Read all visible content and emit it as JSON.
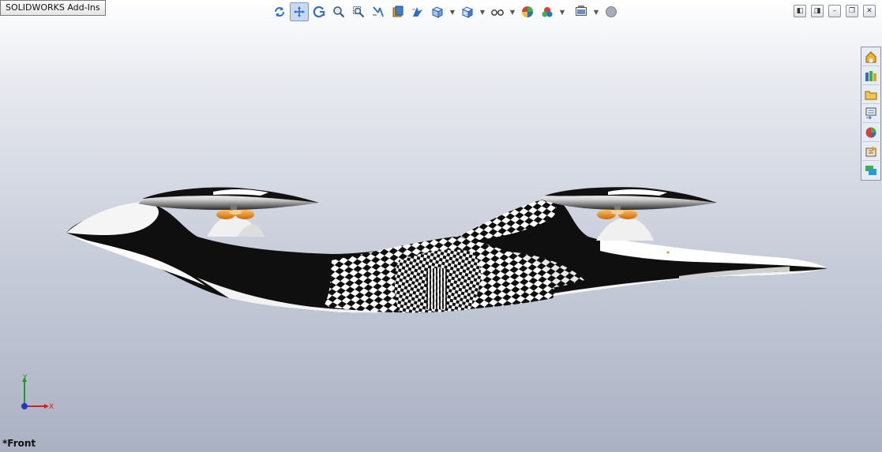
{
  "addins_tab": {
    "label": "SOLIDWORKS Add-Ins"
  },
  "heads_up_toolbar": {
    "tools": [
      {
        "icon": "rotate-view-icon"
      },
      {
        "icon": "pan-icon",
        "active": true
      },
      {
        "icon": "rotate-icon"
      },
      {
        "icon": "zoom-to-fit-icon"
      },
      {
        "icon": "zoom-to-area-icon"
      },
      {
        "icon": "previous-view-icon"
      },
      {
        "icon": "section-view-icon"
      },
      {
        "icon": "dynamic-annotation-icon"
      },
      {
        "icon": "view-orientation-icon",
        "dropdown": true
      },
      {
        "icon": "display-style-icon",
        "dropdown": true
      },
      {
        "icon": "hide-show-items-icon",
        "dropdown": true
      },
      {
        "icon": "edit-appearance-icon"
      },
      {
        "icon": "apply-scene-icon",
        "dropdown": true
      },
      {
        "icon": "view-settings-icon",
        "dropdown": true
      },
      {
        "icon": "realview-icon"
      }
    ]
  },
  "window_controls": [
    "tile-left-icon",
    "tile-right-icon",
    "minimize-icon",
    "restore-icon",
    "close-icon"
  ],
  "task_pane": [
    {
      "icon": "solidworks-resources-icon"
    },
    {
      "icon": "design-library-icon"
    },
    {
      "icon": "file-explorer-icon"
    },
    {
      "icon": "view-palette-icon"
    },
    {
      "icon": "appearances-scenes-icon"
    },
    {
      "icon": "custom-properties-icon"
    },
    {
      "icon": "solidworks-forum-icon"
    }
  ],
  "triad": {
    "x_label": "X",
    "y_label": "Y"
  },
  "view_name": "*Front",
  "colors": {
    "background_top": "#ffffff",
    "background_bottom": "#aab1c2",
    "rotor_orange": "#e8861a",
    "axis_x": "#d21f1f",
    "axis_y": "#1f9a2a",
    "axis_z": "#2634c8"
  }
}
